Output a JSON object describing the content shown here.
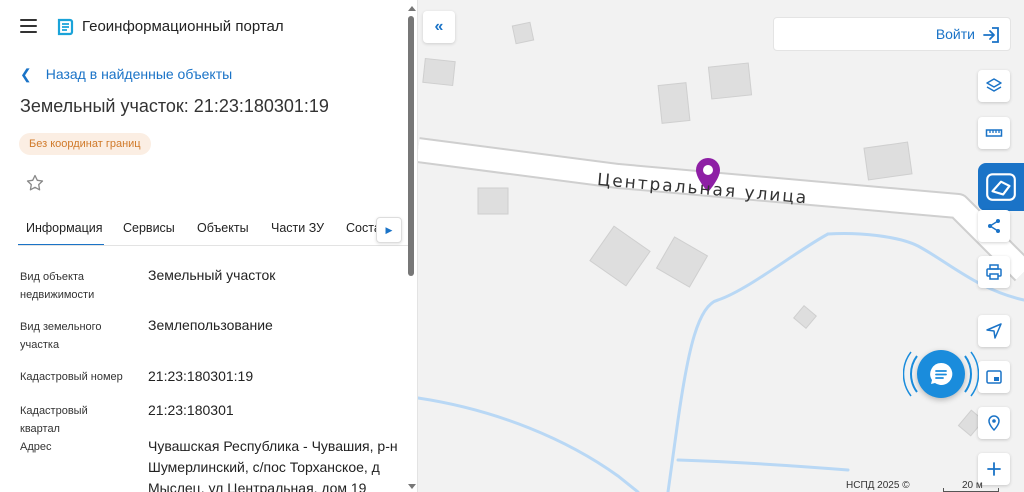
{
  "header": {
    "portal_title": "Геоинформационный портал"
  },
  "navigation": {
    "back_label": "Назад в найденные объекты"
  },
  "object": {
    "title": "Земельный участок: 21:23:180301:19",
    "badge": "Без координат границ"
  },
  "tabs": [
    {
      "label": "Информация",
      "active": true
    },
    {
      "label": "Сервисы"
    },
    {
      "label": "Объекты"
    },
    {
      "label": "Части ЗУ"
    },
    {
      "label": "Соста"
    }
  ],
  "details": [
    {
      "label": "Вид объекта недвижимости",
      "value": "Земельный участок"
    },
    {
      "label": "Вид земельного участка",
      "value": "Землепользование"
    },
    {
      "label": "Кадастровый номер",
      "value": "21:23:180301:19"
    },
    {
      "label": "Кадастровый квартал",
      "value": "21:23:180301"
    },
    {
      "label": "Адрес",
      "value": "Чувашская Республика - Чувашия, р-н Шумерлинский, с/пос Торханское, д Мыслец, ул Центральная, дом 19"
    }
  ],
  "map": {
    "street_label": "Центральная улица",
    "login_label": "Войти",
    "copyright": "НСПД 2025 ©",
    "scale_label": "20 м",
    "marker_color": "#8e1fa5",
    "accent_color": "#1a73c7"
  }
}
